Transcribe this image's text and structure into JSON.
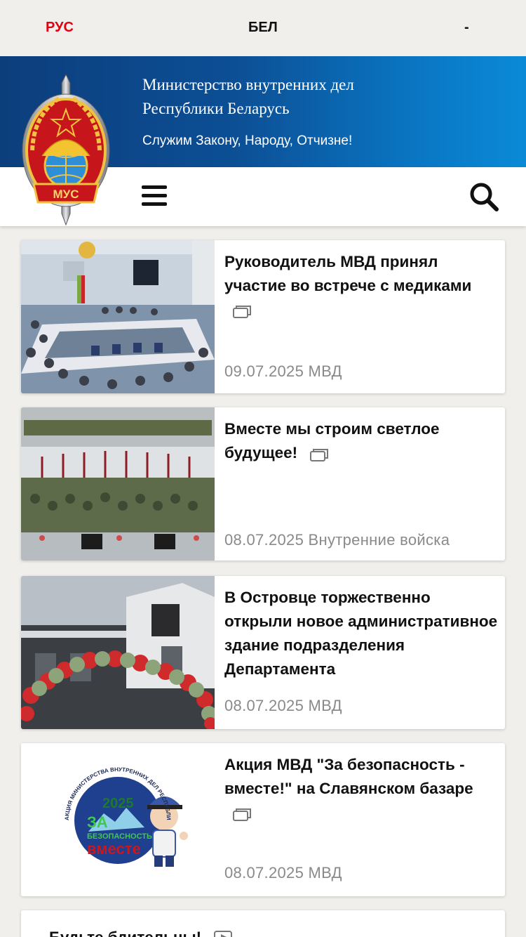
{
  "lang": {
    "ru": "РУС",
    "by": "БЕЛ",
    "other": "-"
  },
  "header": {
    "ministry_line1": "Министерство внутренних дел",
    "ministry_line2": "Республики Беларусь",
    "motto": "Служим Закону, Народу, Отчизне!",
    "emblem_text": "МУС"
  },
  "news": [
    {
      "title": "Руководитель МВД принял участие во встрече с медиками",
      "date": "09.07.2025",
      "source": "МВД",
      "gallery": true
    },
    {
      "title": "Вместе мы строим светлое будущее!",
      "date": "08.07.2025",
      "source": "Внутренние войска",
      "gallery": true
    },
    {
      "title": "В Островце торжественно открыли новое административное здание подразделения Департамента",
      "date": "08.07.2025",
      "source": "МВД",
      "gallery": false
    },
    {
      "title": "Акция МВД \"За безопасность - вместе!\" на Славянском базаре",
      "date": "08.07.2025",
      "source": "МВД",
      "gallery": true
    },
    {
      "title": "Будьте бдительны!",
      "video": true
    }
  ],
  "promo": {
    "year": "2025",
    "ring_text": "АКЦИЯ МИНИСТЕРСТВА ВНУТРЕННИХ ДЕЛ РЕСПУБЛИКИ БЕЛАРУСЬ",
    "za": "ЗА",
    "bezopasnost": "БЕЗОПАСНОСТЬ",
    "vmeste": "вместе"
  },
  "colors": {
    "accent_red": "#e3000f",
    "header_blue_dark": "#0c3e7c",
    "header_blue_light": "#0a8ad6",
    "meta_gray": "#8a8a8a"
  }
}
